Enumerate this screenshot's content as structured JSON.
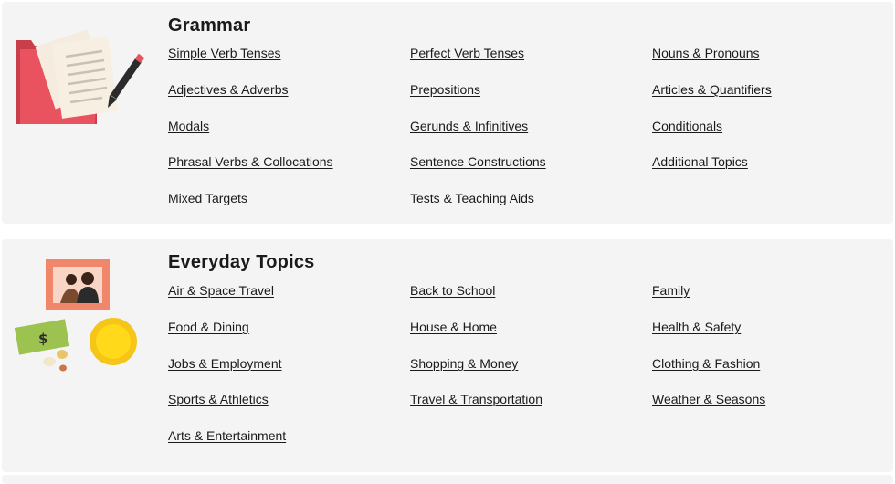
{
  "sections": [
    {
      "title": "Grammar",
      "links": [
        "Simple Verb Tenses",
        "Perfect Verb Tenses",
        "Nouns & Pronouns",
        "Adjectives & Adverbs",
        "Prepositions",
        "Articles & Quantifiers",
        "Modals",
        "Gerunds & Infinitives",
        "Conditionals",
        "Phrasal Verbs & Collocations",
        "Sentence Constructions",
        "Additional Topics",
        "Mixed Targets",
        "Tests & Teaching Aids"
      ]
    },
    {
      "title": "Everyday Topics",
      "links": [
        "Air & Space Travel",
        "Back to School",
        "Family",
        "Food & Dining",
        "House & Home",
        "Health & Safety",
        "Jobs & Employment",
        "Shopping & Money",
        "Clothing & Fashion",
        "Sports & Athletics",
        "Travel & Transportation",
        "Weather & Seasons",
        "Arts & Entertainment"
      ]
    }
  ],
  "illustrations": {
    "grammar": [
      "folder-icon",
      "paper-icon",
      "pencil-icon"
    ],
    "everyday": [
      "family-photo-icon",
      "money-icon",
      "coins-icon",
      "sun-icon"
    ]
  },
  "colors": {
    "panel_bg": "#f4f4f4",
    "folder": "#e8535f",
    "frame": "#f0866a",
    "money": "#9cc24f",
    "sun": "#f5c518"
  }
}
